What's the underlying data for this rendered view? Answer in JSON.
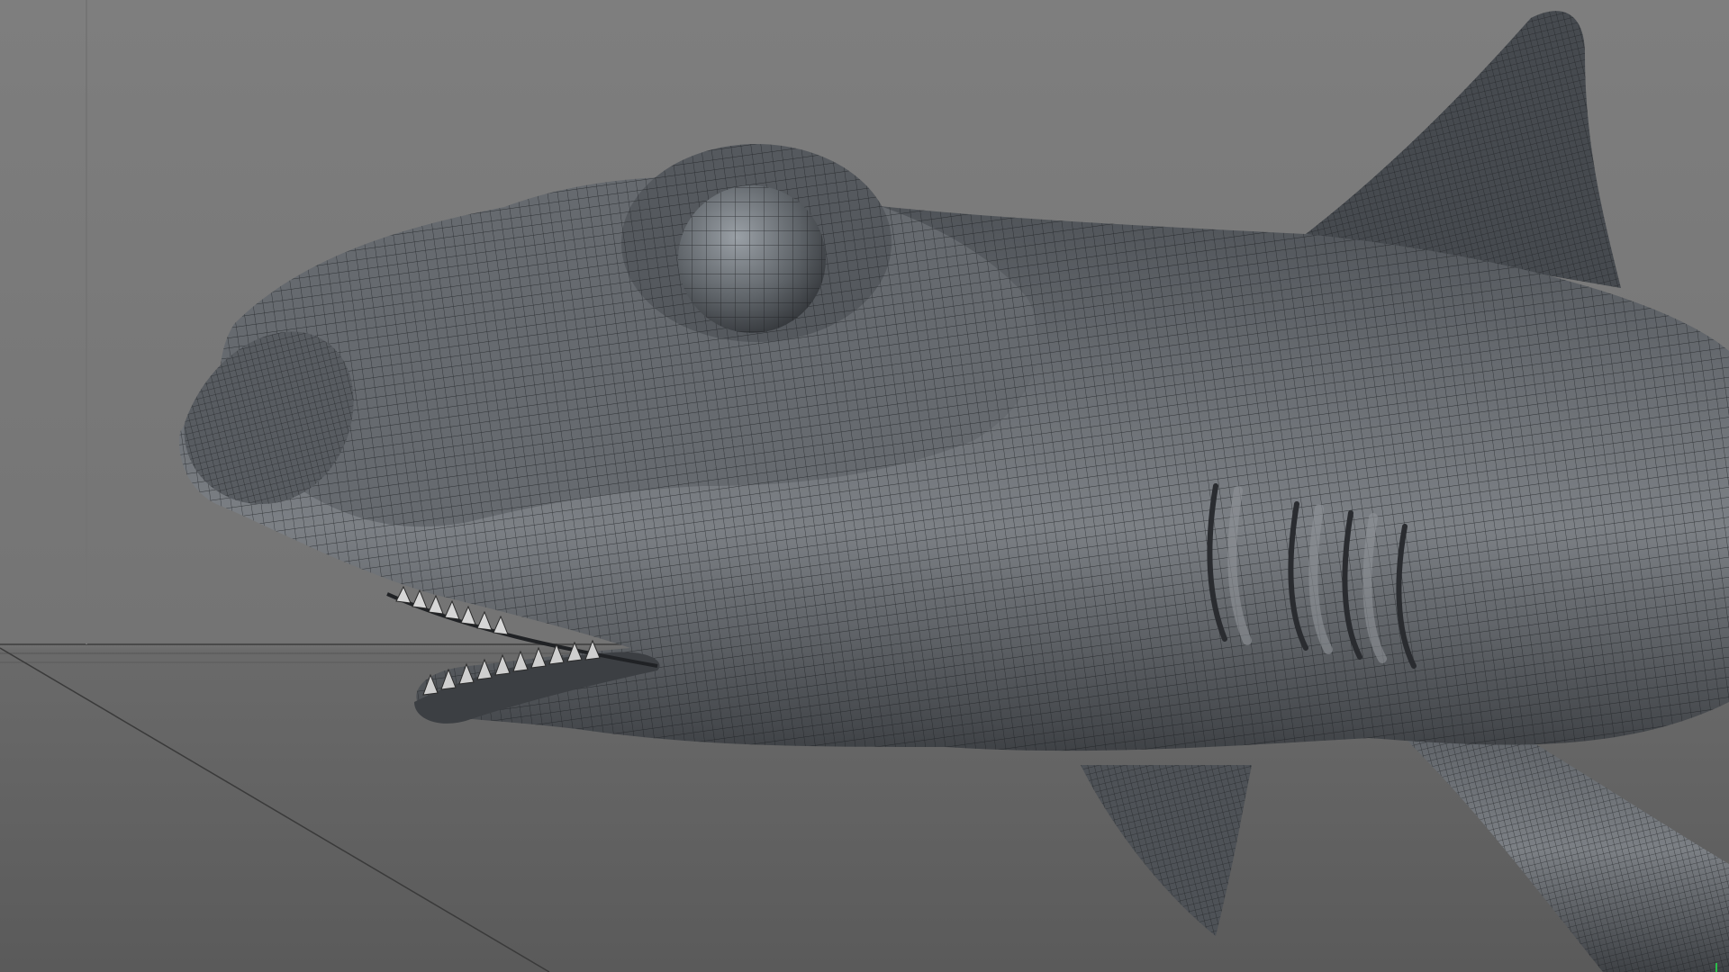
{
  "viewport": {
    "mode": "3d-modeling-viewport",
    "background_color": "#7b7b7b",
    "floor_color": "#5f5f5f",
    "mesh_color": "#5a5e63",
    "wire_color": "#1f2124",
    "subject": "polygon-mesh-shark-model",
    "grid_visible": true,
    "wireframe_on_shaded": true,
    "axis_marker_color": "#2bbf4a"
  }
}
